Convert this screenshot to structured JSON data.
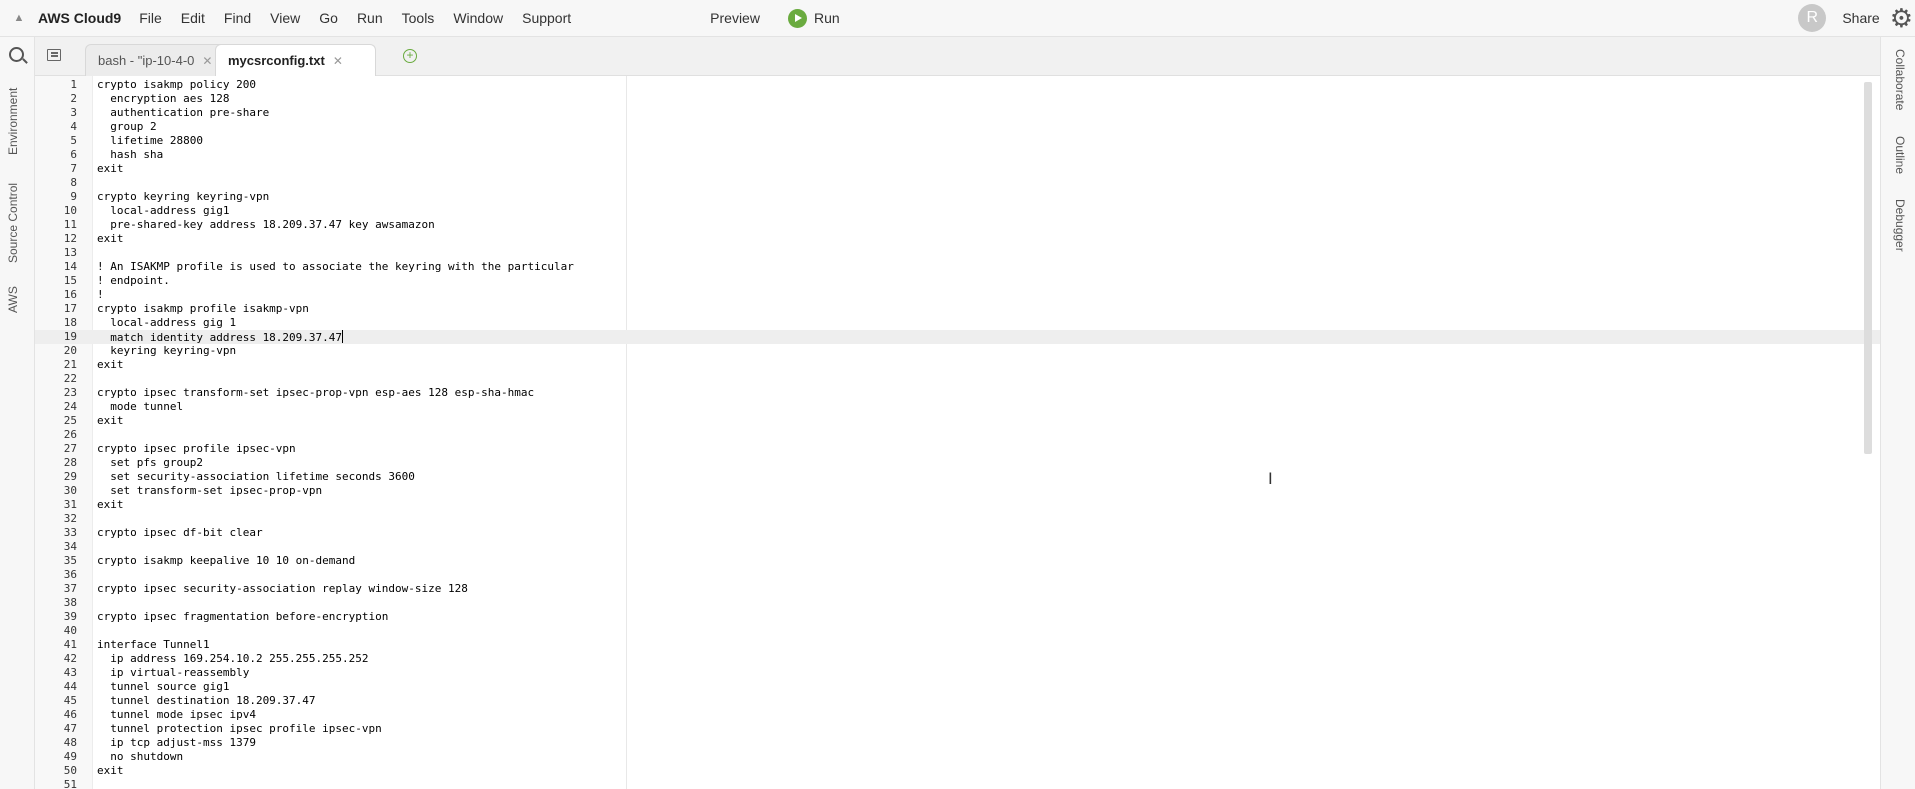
{
  "menubar": {
    "brand": "AWS Cloud9",
    "items": [
      "File",
      "Edit",
      "Find",
      "View",
      "Go",
      "Run",
      "Tools",
      "Window",
      "Support"
    ],
    "preview": "Preview",
    "run": "Run",
    "avatar_letter": "R",
    "share": "Share"
  },
  "left_rail": {
    "tabs": [
      "Environment",
      "Source Control",
      "AWS"
    ]
  },
  "right_rail": {
    "tabs": [
      "Collaborate",
      "Outline",
      "Debugger"
    ]
  },
  "tabs": [
    {
      "label": "bash - \"ip-10-4-0",
      "active": false
    },
    {
      "label": "mycsrconfig.txt",
      "active": true
    }
  ],
  "editor": {
    "current_line": 19,
    "lines": [
      "crypto isakmp policy 200",
      "  encryption aes 128",
      "  authentication pre-share",
      "  group 2",
      "  lifetime 28800",
      "  hash sha",
      "exit",
      "",
      "crypto keyring keyring-vpn",
      "  local-address gig1",
      "  pre-shared-key address 18.209.37.47 key awsamazon",
      "exit",
      "",
      "! An ISAKMP profile is used to associate the keyring with the particular",
      "! endpoint.",
      "!",
      "crypto isakmp profile isakmp-vpn",
      "  local-address gig 1",
      "  match identity address 18.209.37.47",
      "  keyring keyring-vpn",
      "exit",
      "",
      "crypto ipsec transform-set ipsec-prop-vpn esp-aes 128 esp-sha-hmac",
      "  mode tunnel",
      "exit",
      "",
      "crypto ipsec profile ipsec-vpn",
      "  set pfs group2",
      "  set security-association lifetime seconds 3600",
      "  set transform-set ipsec-prop-vpn",
      "exit",
      "",
      "crypto ipsec df-bit clear",
      "",
      "crypto isakmp keepalive 10 10 on-demand",
      "",
      "crypto ipsec security-association replay window-size 128",
      "",
      "crypto ipsec fragmentation before-encryption",
      "",
      "interface Tunnel1",
      "  ip address 169.254.10.2 255.255.255.252",
      "  ip virtual-reassembly",
      "  tunnel source gig1",
      "  tunnel destination 18.209.37.47",
      "  tunnel mode ipsec ipv4",
      "  tunnel protection ipsec profile ipsec-vpn",
      "  ip tcp adjust-mss 1379",
      "  no shutdown",
      "exit",
      ""
    ]
  }
}
